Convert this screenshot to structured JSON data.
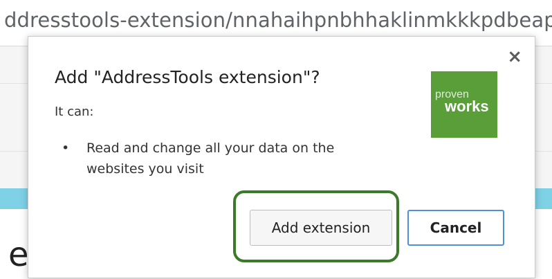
{
  "browser": {
    "url_fragment": "ddresstools-extension/nnahaihpnbhhaklinmkkkpdbeapj",
    "page_partial_char": "e"
  },
  "dialog": {
    "title": "Add \"AddressTools extension\"?",
    "subtitle": "It can:",
    "permissions": [
      "Read and change all your data on the websites you visit"
    ],
    "bullet": "•",
    "close_glyph": "×",
    "add_button": "Add extension",
    "cancel_button": "Cancel",
    "logo": {
      "text_top": "proven",
      "text_bottom": "works",
      "bg_color": "#5a9e3a"
    }
  },
  "colors": {
    "highlight_border": "#3a7a2a",
    "cancel_border": "#4f8ed8",
    "cyan_band": "#7fd1e6"
  }
}
